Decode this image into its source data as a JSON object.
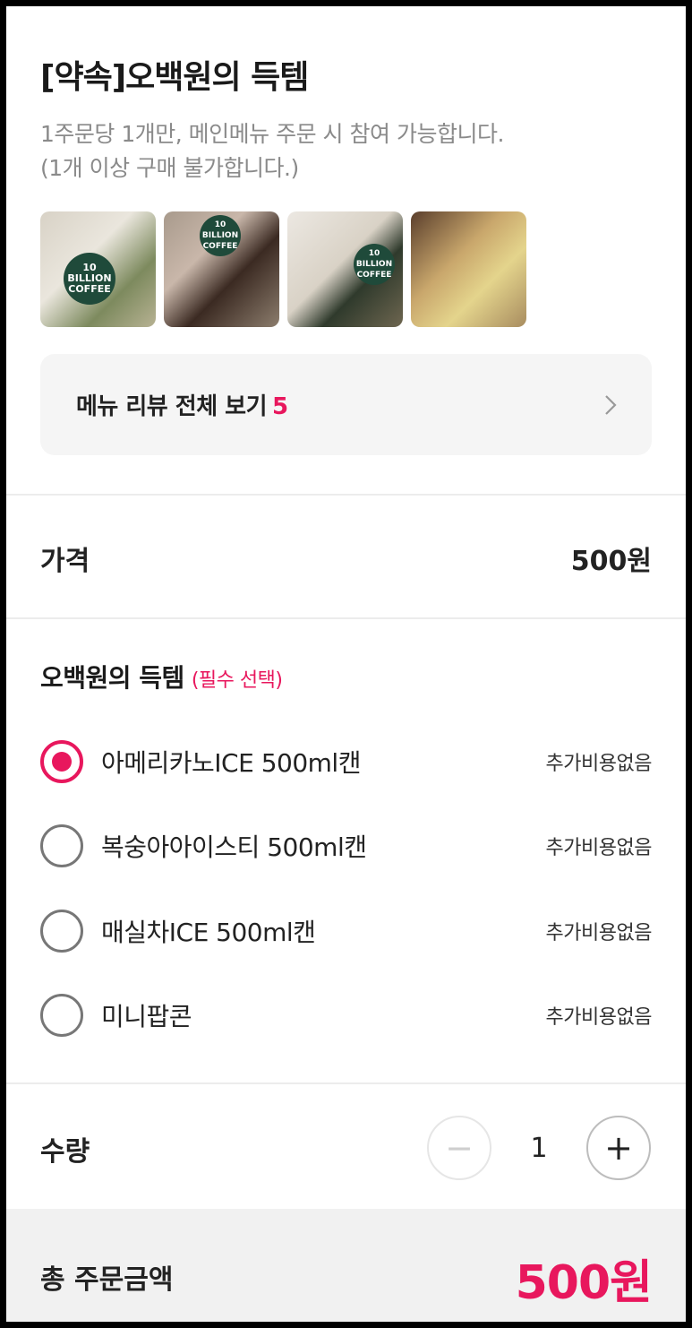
{
  "menu": {
    "title": "[약속]오백원의 득템",
    "description_lines": [
      "1주문당 1개만, 메인메뉴 주문 시 참여 가능합니다.",
      "(1개 이상 구매 불가합니다.)"
    ]
  },
  "photos": [
    {
      "icon": "photo-iced-latte-cup",
      "badge_text": "10 BILLION COFFEE"
    },
    {
      "icon": "photo-bottle-and-sandwich",
      "badge_text": "10 BILLION COFFEE"
    },
    {
      "icon": "photo-latte-and-can",
      "badge_text": "10 BILLION COFFEE"
    },
    {
      "icon": "photo-baked-goods",
      "badge_text": ""
    }
  ],
  "reviews": {
    "label": "메뉴 리뷰 전체 보기",
    "count": "5"
  },
  "price": {
    "label": "가격",
    "value": "500원"
  },
  "option_group": {
    "title": "오백원의 득템",
    "required_tag": "(필수 선택)",
    "options": [
      {
        "name": "아메리카노ICE 500ml캔",
        "cost": "추가비용없음",
        "selected": true
      },
      {
        "name": "복숭아아이스티 500ml캔",
        "cost": "추가비용없음",
        "selected": false
      },
      {
        "name": "매실차ICE 500ml캔",
        "cost": "추가비용없음",
        "selected": false
      },
      {
        "name": "미니팝콘",
        "cost": "추가비용없음",
        "selected": false
      }
    ]
  },
  "quantity": {
    "label": "수량",
    "value": "1",
    "minus_symbol": "−",
    "plus_symbol": "+"
  },
  "total": {
    "label": "총 주문금액",
    "value": "500원"
  },
  "colors": {
    "accent": "#e8175d",
    "review_box_bg": "#f5f5f5",
    "total_bar_bg": "#f1f1f1"
  }
}
